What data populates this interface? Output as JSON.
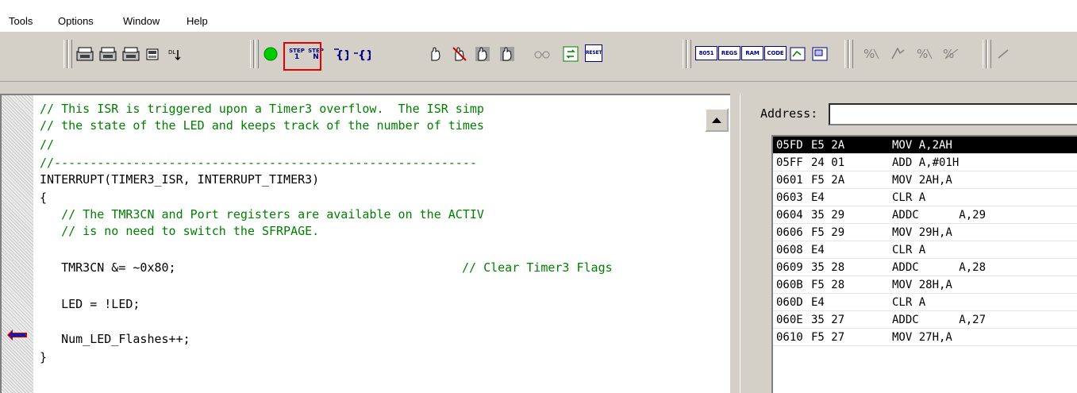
{
  "menu": [
    "Tools",
    "Options",
    "Window",
    "Help"
  ],
  "toolbar": {
    "step_top": "STEP",
    "step_into_num": "1",
    "step_over_mark": "N",
    "chip_buttons": [
      "8051",
      "REGS",
      "RAM",
      "CODE"
    ],
    "reset_label": "RESET"
  },
  "editor": {
    "lines": [
      {
        "cls": "cm",
        "text": "// This ISR is triggered upon a Timer3 overflow.  The ISR simp"
      },
      {
        "cls": "cm",
        "text": "// the state of the LED and keeps track of the number of times"
      },
      {
        "cls": "cm",
        "text": "//"
      },
      {
        "cls": "cm",
        "text": "//-----------------------------------------------------------"
      },
      {
        "cls": "pl",
        "text": "INTERRUPT(TIMER3_ISR, INTERRUPT_TIMER3)"
      },
      {
        "cls": "pl",
        "text": "{"
      },
      {
        "cls": "cm",
        "text": "   // The TMR3CN and Port registers are available on the ACTIV"
      },
      {
        "cls": "cm",
        "text": "   // is no need to switch the SFRPAGE."
      },
      {
        "cls": "pl",
        "text": ""
      },
      {
        "cls": "mix",
        "text": "   TMR3CN &= ~0x80;",
        "comment": "// Clear Timer3 Flags"
      },
      {
        "cls": "pl",
        "text": ""
      },
      {
        "cls": "pl",
        "text": "   LED = !LED;"
      },
      {
        "cls": "pl",
        "text": ""
      },
      {
        "cls": "pl",
        "text": "   Num_LED_Flashes++;"
      },
      {
        "cls": "pl",
        "text": "}"
      }
    ]
  },
  "disasm": {
    "address_label": "Address:",
    "address_value": "",
    "rows": [
      {
        "addr": "05FD",
        "bytes": "E5 2A",
        "instr": "MOV A,2AH",
        "selected": true
      },
      {
        "addr": "05FF",
        "bytes": "24 01",
        "instr": "ADD A,#01H",
        "selected": false
      },
      {
        "addr": "0601",
        "bytes": "F5 2A",
        "instr": "MOV 2AH,A",
        "selected": false
      },
      {
        "addr": "0603",
        "bytes": "E4",
        "instr": "CLR A",
        "selected": false
      },
      {
        "addr": "0604",
        "bytes": "35 29",
        "instr": "ADDC      A,29",
        "selected": false
      },
      {
        "addr": "0606",
        "bytes": "F5 29",
        "instr": "MOV 29H,A",
        "selected": false
      },
      {
        "addr": "0608",
        "bytes": "E4",
        "instr": "CLR A",
        "selected": false
      },
      {
        "addr": "0609",
        "bytes": "35 28",
        "instr": "ADDC      A,28",
        "selected": false
      },
      {
        "addr": "060B",
        "bytes": "F5 28",
        "instr": "MOV 28H,A",
        "selected": false
      },
      {
        "addr": "060D",
        "bytes": "E4",
        "instr": "CLR A",
        "selected": false
      },
      {
        "addr": "060E",
        "bytes": "35 27",
        "instr": "ADDC      A,27",
        "selected": false
      },
      {
        "addr": "0610",
        "bytes": "F5 27",
        "instr": "MOV 27H,A",
        "selected": false
      }
    ]
  },
  "colors": {
    "comment": "#008000",
    "highlight_border": "#e10000",
    "run_button": "#00cc00",
    "breakpoint": "#cc0000"
  }
}
